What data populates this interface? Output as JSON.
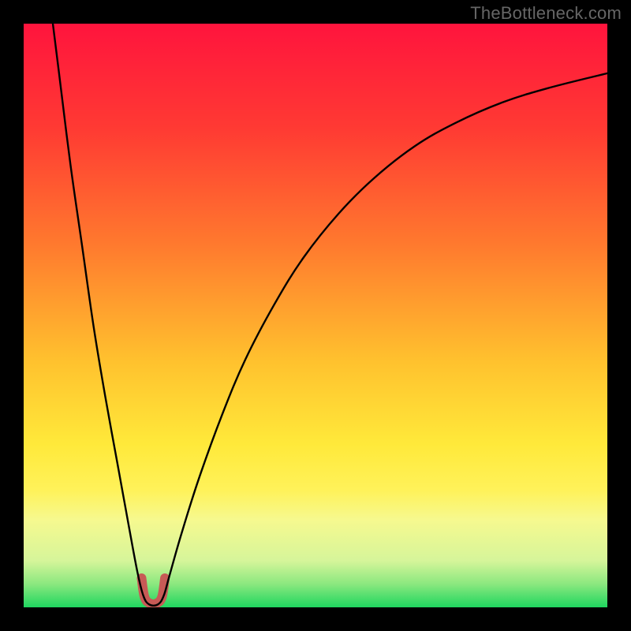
{
  "watermark": "TheBottleneck.com",
  "chart_data": {
    "type": "line",
    "title": "",
    "xlabel": "",
    "ylabel": "",
    "xlim": [
      0,
      100
    ],
    "ylim": [
      0,
      100
    ],
    "gradient_stops": [
      {
        "offset": 0,
        "color": "#ff143d"
      },
      {
        "offset": 18,
        "color": "#ff3a33"
      },
      {
        "offset": 38,
        "color": "#ff7a2e"
      },
      {
        "offset": 58,
        "color": "#ffc22e"
      },
      {
        "offset": 72,
        "color": "#ffe93a"
      },
      {
        "offset": 80,
        "color": "#fff25a"
      },
      {
        "offset": 85,
        "color": "#f6f98f"
      },
      {
        "offset": 92,
        "color": "#d6f59a"
      },
      {
        "offset": 96,
        "color": "#8be87f"
      },
      {
        "offset": 100,
        "color": "#1fd65f"
      }
    ],
    "series": [
      {
        "name": "bottleneck-curve",
        "stroke": "#000000",
        "stroke_width": 2.4,
        "points": [
          {
            "x": 5.0,
            "y": 100.0
          },
          {
            "x": 6.0,
            "y": 92.0
          },
          {
            "x": 8.0,
            "y": 76.0
          },
          {
            "x": 10.0,
            "y": 62.0
          },
          {
            "x": 12.0,
            "y": 48.0
          },
          {
            "x": 14.0,
            "y": 36.0
          },
          {
            "x": 16.0,
            "y": 25.0
          },
          {
            "x": 18.0,
            "y": 14.0
          },
          {
            "x": 19.5,
            "y": 6.0
          },
          {
            "x": 20.5,
            "y": 2.0
          },
          {
            "x": 21.5,
            "y": 0.5
          },
          {
            "x": 23.0,
            "y": 0.5
          },
          {
            "x": 24.0,
            "y": 2.0
          },
          {
            "x": 25.0,
            "y": 5.5
          },
          {
            "x": 27.0,
            "y": 12.5
          },
          {
            "x": 30.0,
            "y": 22.0
          },
          {
            "x": 34.0,
            "y": 33.0
          },
          {
            "x": 38.0,
            "y": 42.5
          },
          {
            "x": 43.0,
            "y": 52.0
          },
          {
            "x": 48.0,
            "y": 60.0
          },
          {
            "x": 54.0,
            "y": 67.5
          },
          {
            "x": 60.0,
            "y": 73.5
          },
          {
            "x": 67.0,
            "y": 79.0
          },
          {
            "x": 74.0,
            "y": 83.0
          },
          {
            "x": 82.0,
            "y": 86.5
          },
          {
            "x": 90.0,
            "y": 89.0
          },
          {
            "x": 100.0,
            "y": 91.5
          }
        ]
      }
    ],
    "dip_marker": {
      "stroke": "#c75a56",
      "stroke_width": 12,
      "points": [
        {
          "x": 20.2,
          "y": 5.0
        },
        {
          "x": 20.7,
          "y": 1.8
        },
        {
          "x": 21.6,
          "y": 0.7
        },
        {
          "x": 22.8,
          "y": 0.7
        },
        {
          "x": 23.7,
          "y": 1.8
        },
        {
          "x": 24.2,
          "y": 5.0
        }
      ]
    }
  }
}
